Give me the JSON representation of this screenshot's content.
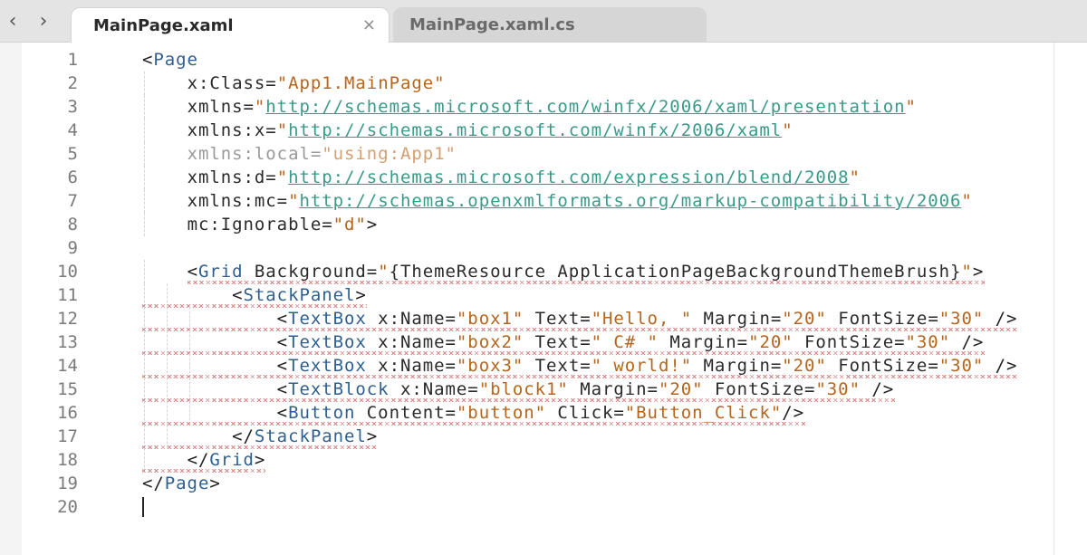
{
  "navigation": {
    "back_label": "‹",
    "forward_label": "›"
  },
  "tabs": [
    {
      "label": "MainPage.xaml",
      "active": true,
      "close_label": "×"
    },
    {
      "label": "MainPage.xaml.cs",
      "active": false
    }
  ],
  "colors": {
    "tag": "#2f5f8f",
    "attribute_value": "#b5651d",
    "url": "#3a9a8a",
    "error_squiggle": "#d98a8a"
  },
  "editor": {
    "line_numbers": [
      "1",
      "2",
      "3",
      "4",
      "5",
      "6",
      "7",
      "8",
      "9",
      "10",
      "11",
      "12",
      "13",
      "14",
      "15",
      "16",
      "17",
      "18",
      "19",
      "20"
    ],
    "lines": [
      {
        "indent": 0,
        "tokens": [
          [
            "p",
            "<"
          ],
          [
            "tag",
            "Page"
          ]
        ]
      },
      {
        "indent": 2,
        "tokens": [
          [
            "attr",
            "x:Class="
          ],
          [
            "val",
            "\"App1.MainPage\""
          ]
        ]
      },
      {
        "indent": 2,
        "tokens": [
          [
            "attr",
            "xmlns="
          ],
          [
            "val",
            "\""
          ],
          [
            "url",
            "http://schemas.microsoft.com/winfx/2006/xaml/presentation"
          ],
          [
            "val",
            "\""
          ]
        ]
      },
      {
        "indent": 2,
        "tokens": [
          [
            "attr",
            "xmlns:x="
          ],
          [
            "val",
            "\""
          ],
          [
            "url",
            "http://schemas.microsoft.com/winfx/2006/xaml"
          ],
          [
            "val",
            "\""
          ]
        ]
      },
      {
        "indent": 2,
        "tokens": [
          [
            "dim",
            "xmlns:local="
          ],
          [
            "dimval",
            "\"using:App1\""
          ]
        ]
      },
      {
        "indent": 2,
        "tokens": [
          [
            "attr",
            "xmlns:d="
          ],
          [
            "val",
            "\""
          ],
          [
            "url",
            "http://schemas.microsoft.com/expression/blend/2008"
          ],
          [
            "val",
            "\""
          ]
        ]
      },
      {
        "indent": 2,
        "tokens": [
          [
            "attr",
            "xmlns:mc="
          ],
          [
            "val",
            "\""
          ],
          [
            "url",
            "http://schemas.openxmlformats.org/markup-compatibility/2006"
          ],
          [
            "val",
            "\""
          ]
        ]
      },
      {
        "indent": 2,
        "tokens": [
          [
            "attr",
            "mc:Ignorable="
          ],
          [
            "val",
            "\"d\""
          ],
          [
            "p",
            ">"
          ]
        ]
      },
      {
        "indent": 0,
        "tokens": []
      },
      {
        "indent": 2,
        "tokens": [
          [
            "p",
            "<"
          ],
          [
            "tag",
            "Grid"
          ],
          [
            "attr",
            " Background="
          ],
          [
            "val",
            "\""
          ],
          [
            "attr",
            "{ThemeResource ApplicationPageBackgroundThemeBrush}"
          ],
          [
            "val",
            "\""
          ],
          [
            "p",
            ">"
          ]
        ]
      },
      {
        "indent": 4,
        "tokens": [
          [
            "p",
            "<"
          ],
          [
            "tag",
            "StackPanel"
          ],
          [
            "p",
            ">"
          ]
        ]
      },
      {
        "indent": 6,
        "tokens": [
          [
            "p",
            "<"
          ],
          [
            "tag",
            "TextBox"
          ],
          [
            "attr",
            " x:Name="
          ],
          [
            "val",
            "\"box1\""
          ],
          [
            "attr",
            " Text="
          ],
          [
            "val",
            "\"Hello, \""
          ],
          [
            "attr",
            " Margin="
          ],
          [
            "val",
            "\"20\""
          ],
          [
            "attr",
            " FontSize="
          ],
          [
            "val",
            "\"30\""
          ],
          [
            "p",
            " />"
          ]
        ]
      },
      {
        "indent": 6,
        "tokens": [
          [
            "p",
            "<"
          ],
          [
            "tag",
            "TextBox"
          ],
          [
            "attr",
            " x:Name="
          ],
          [
            "val",
            "\"box2\""
          ],
          [
            "attr",
            " Text="
          ],
          [
            "val",
            "\" C# \""
          ],
          [
            "attr",
            " Margin="
          ],
          [
            "val",
            "\"20\""
          ],
          [
            "attr",
            " FontSize="
          ],
          [
            "val",
            "\"30\""
          ],
          [
            "p",
            " />"
          ]
        ]
      },
      {
        "indent": 6,
        "tokens": [
          [
            "p",
            "<"
          ],
          [
            "tag",
            "TextBox"
          ],
          [
            "attr",
            " x:Name="
          ],
          [
            "val",
            "\"box3\""
          ],
          [
            "attr",
            " Text="
          ],
          [
            "val",
            "\" world!\""
          ],
          [
            "attr",
            " Margin="
          ],
          [
            "val",
            "\"20\""
          ],
          [
            "attr",
            " FontSize="
          ],
          [
            "val",
            "\"30\""
          ],
          [
            "p",
            " />"
          ]
        ]
      },
      {
        "indent": 6,
        "tokens": [
          [
            "p",
            "<"
          ],
          [
            "tag",
            "TextBlock"
          ],
          [
            "attr",
            " x:Name="
          ],
          [
            "val",
            "\"block1\""
          ],
          [
            "attr",
            " Margin="
          ],
          [
            "val",
            "\"20\""
          ],
          [
            "attr",
            " FontSize="
          ],
          [
            "val",
            "\"30\""
          ],
          [
            "p",
            " />"
          ]
        ]
      },
      {
        "indent": 6,
        "tokens": [
          [
            "p",
            "<"
          ],
          [
            "tag",
            "Button"
          ],
          [
            "attr",
            " Content="
          ],
          [
            "val",
            "\"button\""
          ],
          [
            "attr",
            " Click="
          ],
          [
            "val",
            "\"Button_Click\""
          ],
          [
            "p",
            "/>"
          ]
        ]
      },
      {
        "indent": 4,
        "tokens": [
          [
            "p",
            "</"
          ],
          [
            "tag",
            "StackPanel"
          ],
          [
            "p",
            ">"
          ]
        ]
      },
      {
        "indent": 2,
        "tokens": [
          [
            "p",
            "</"
          ],
          [
            "tag",
            "Grid"
          ],
          [
            "p",
            ">"
          ]
        ]
      },
      {
        "indent": 0,
        "tokens": [
          [
            "p",
            "</"
          ],
          [
            "tag",
            "Page"
          ],
          [
            "p",
            ">"
          ]
        ]
      },
      {
        "indent": 0,
        "tokens": [],
        "cursor": true
      }
    ]
  }
}
